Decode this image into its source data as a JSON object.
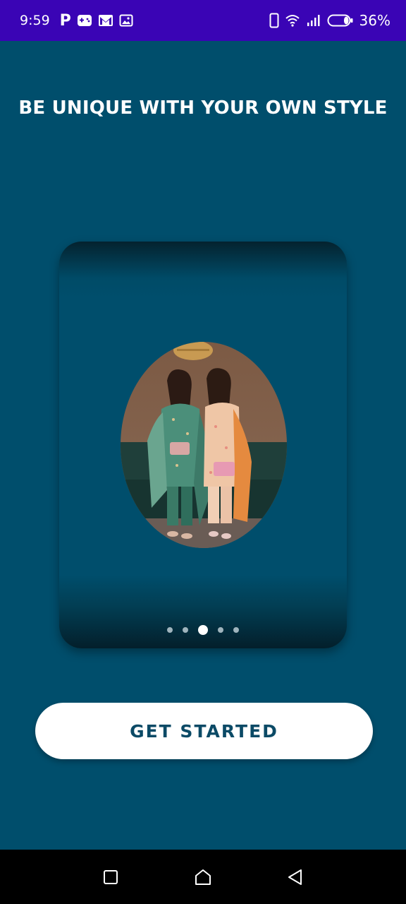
{
  "status_bar": {
    "time": "9:59",
    "battery_percent": "36%",
    "icons": [
      "parking-icon",
      "gamepad-icon",
      "gmail-icon",
      "gallery-icon",
      "phone-icon",
      "wifi-icon",
      "signal-icon",
      "battery-icon"
    ]
  },
  "onboarding": {
    "headline": "BE UNIQUE WITH YOUR OWN STYLE",
    "carousel": {
      "total_pages": 5,
      "active_page": 3
    }
  },
  "cta": {
    "label": "GET STARTED"
  },
  "nav": {
    "buttons": [
      "recents-icon",
      "home-icon",
      "back-icon"
    ]
  },
  "colors": {
    "status_bar": "#3a04b5",
    "background": "#004e6c",
    "button_text": "#0b4a66",
    "button_bg": "#ffffff"
  }
}
